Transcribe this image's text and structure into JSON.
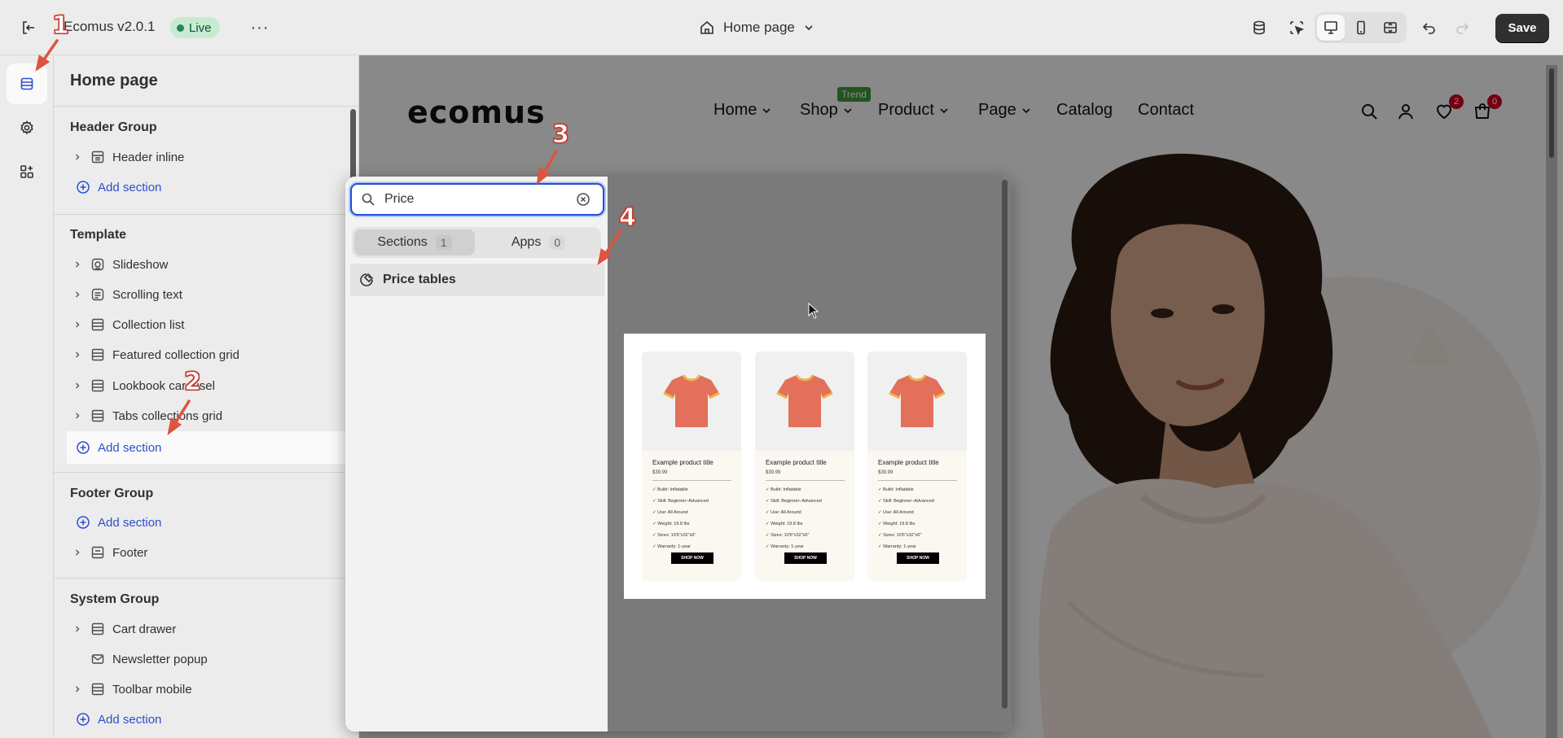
{
  "topbar": {
    "app_name": "Ecomus v2.0.1",
    "status_badge": "Live",
    "more_label": "···",
    "page_selector": "Home page",
    "save_label": "Save"
  },
  "sidebar": {
    "title": "Home page",
    "groups": [
      {
        "title": "Header Group",
        "items": [
          "Header inline"
        ],
        "add_label": "Add section"
      },
      {
        "title": "Template",
        "items": [
          "Slideshow",
          "Scrolling text",
          "Collection list",
          "Featured collection grid",
          "Lookbook carousel",
          "Tabs collections grid"
        ],
        "add_label": "Add section"
      },
      {
        "title": "Footer Group",
        "items": [
          "Footer"
        ],
        "add_label": "Add section"
      },
      {
        "title": "System Group",
        "items": [
          "Cart drawer",
          "Newsletter popup",
          "Toolbar mobile"
        ],
        "add_label": "Add section"
      }
    ]
  },
  "picker": {
    "search_value": "Price",
    "tabs": [
      {
        "label": "Sections",
        "count": "1"
      },
      {
        "label": "Apps",
        "count": "0"
      }
    ],
    "result": "Price tables",
    "preview_cards": [
      {
        "title": "Example product title",
        "price": "$39.99",
        "features": [
          "✓  Build: Inflatable",
          "✓  Skill: Beginner–Advanced",
          "✓  Use: All Around",
          "✓  Weight: 19.8 lbs",
          "✓  Sizes: 10'6\"x32\"x6\"",
          "✓  Warranty: 1-year"
        ],
        "button": "SHOP NOW"
      },
      {
        "title": "Example product title",
        "price": "$39.99",
        "features": [
          "✓  Build: Inflatable",
          "✓  Skill: Beginner–Advanced",
          "✓  Use: All Around",
          "✓  Weight: 19.8 lbs",
          "✓  Sizes: 10'6\"x32\"x6\"",
          "✓  Warranty: 1-year"
        ],
        "button": "SHOP NOW"
      },
      {
        "title": "Example product title",
        "price": "$39.99",
        "features": [
          "✓  Build: Inflatable",
          "✓  Skill: Beginner–Advanced",
          "✓  Use: All Around",
          "✓  Weight: 19.8 lbs",
          "✓  Sizes: 10'6\"x32\"x6\"",
          "✓  Warranty: 1-year"
        ],
        "button": "SHOP NOW"
      }
    ]
  },
  "storefront": {
    "logo": "ecomus",
    "nav": [
      "Home",
      "Shop",
      "Product",
      "Page",
      "Catalog",
      "Contact"
    ],
    "trend_tag": "Trend",
    "wishlist_count": "2",
    "cart_count": "0"
  },
  "annotations": [
    "1",
    "2",
    "3",
    "4"
  ],
  "colors": {
    "accent": "#2c4ed0",
    "live_green": "#29845a",
    "annotation": "#d23f2f",
    "save_bg": "#303030"
  }
}
